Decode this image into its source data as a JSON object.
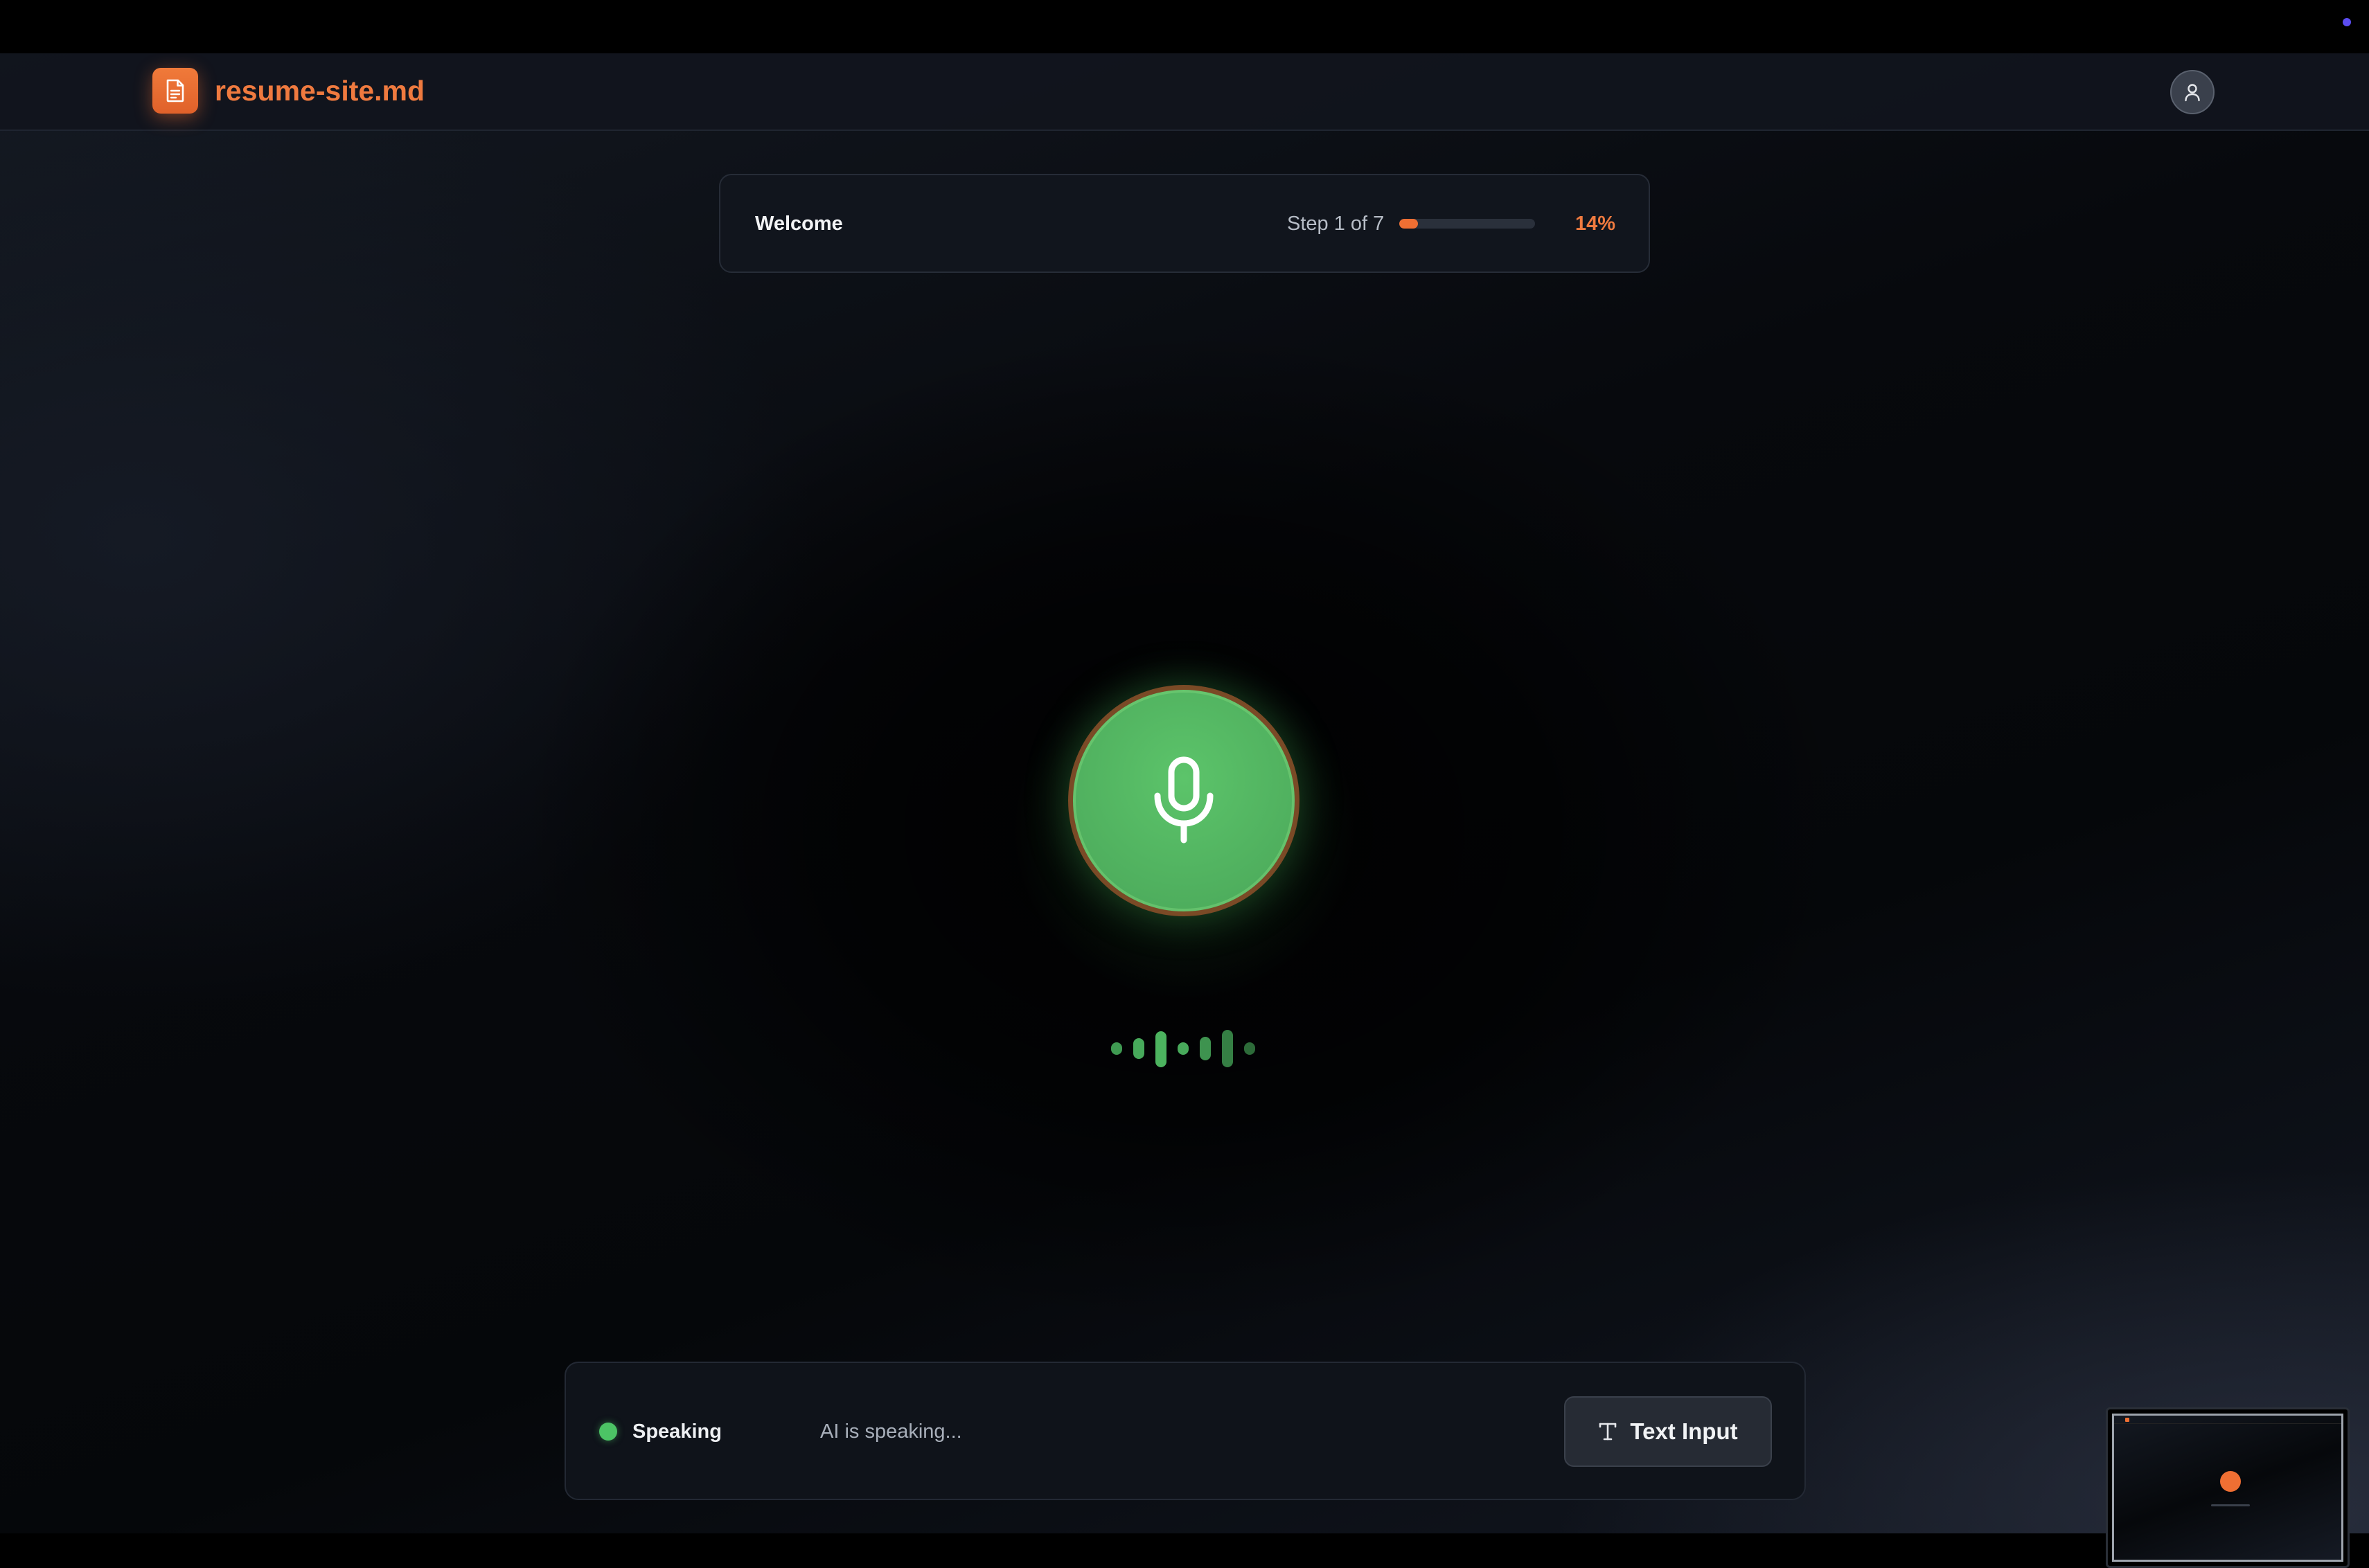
{
  "header": {
    "brand": "resume-site.md",
    "logo_icon": "document-icon",
    "avatar_icon": "user-icon"
  },
  "progress": {
    "step_title": "Welcome",
    "step_count": "Step 1 of 7",
    "percent_label": "14%",
    "percent": 14
  },
  "mic": {
    "icon": "microphone-icon",
    "state_color": "#4faf5e"
  },
  "status": {
    "label": "Speaking",
    "message": "AI is speaking...",
    "text_input_label": "Text Input",
    "text_input_icon": "text-icon"
  },
  "colors": {
    "accent": "#ef7a3f",
    "speaking": "#4cc465"
  }
}
